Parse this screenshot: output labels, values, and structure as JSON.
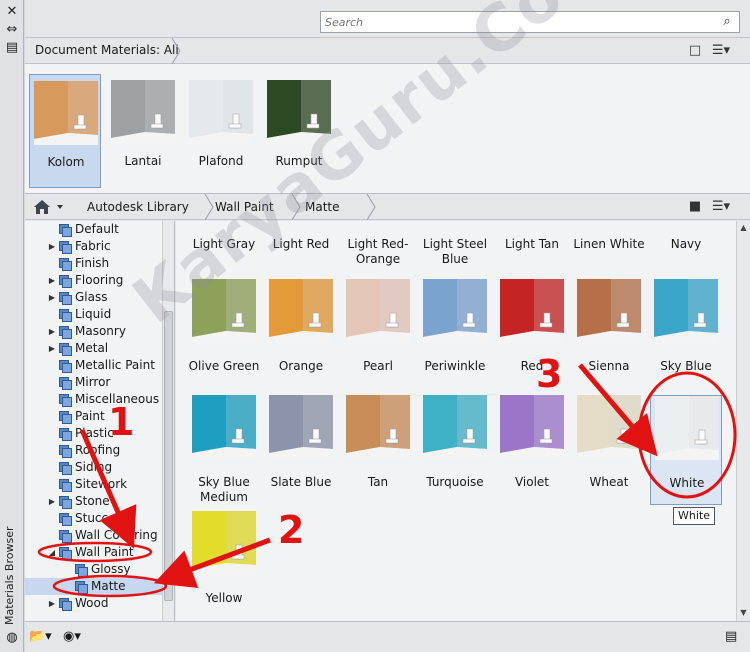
{
  "search": {
    "placeholder": "Search"
  },
  "strip": {
    "close_glyph": "✕",
    "pin_glyph": "⇔",
    "menu_glyph": "▤",
    "title": "Materials Browser",
    "bottom_glyph": "◍"
  },
  "doc_header": {
    "label": "Document Materials: All"
  },
  "doc_materials": [
    {
      "name": "Kolom",
      "color": "#d79a5c",
      "selected": true
    },
    {
      "name": "Lantai",
      "color": "#9ea0a1",
      "selected": false
    },
    {
      "name": "Plafond",
      "color": "#e6e9ec",
      "selected": false
    },
    {
      "name": "Rumput",
      "color": "#2e4a24",
      "selected": false
    }
  ],
  "breadcrumb": [
    "Autodesk Library",
    "Wall Paint",
    "Matte"
  ],
  "tree": [
    {
      "label": "Default",
      "exp": false,
      "level": 1,
      "sel": false
    },
    {
      "label": "Fabric",
      "exp": true,
      "level": 1,
      "sel": false
    },
    {
      "label": "Finish",
      "exp": false,
      "level": 1,
      "sel": false
    },
    {
      "label": "Flooring",
      "exp": true,
      "level": 1,
      "sel": false
    },
    {
      "label": "Glass",
      "exp": true,
      "level": 1,
      "sel": false
    },
    {
      "label": "Liquid",
      "exp": false,
      "level": 1,
      "sel": false
    },
    {
      "label": "Masonry",
      "exp": true,
      "level": 1,
      "sel": false
    },
    {
      "label": "Metal",
      "exp": true,
      "level": 1,
      "sel": false
    },
    {
      "label": "Metallic Paint",
      "exp": false,
      "level": 1,
      "sel": false
    },
    {
      "label": "Mirror",
      "exp": false,
      "level": 1,
      "sel": false
    },
    {
      "label": "Miscellaneous",
      "exp": false,
      "level": 1,
      "sel": false
    },
    {
      "label": "Paint",
      "exp": false,
      "level": 1,
      "sel": false
    },
    {
      "label": "Plastic",
      "exp": false,
      "level": 1,
      "sel": false
    },
    {
      "label": "Roofing",
      "exp": false,
      "level": 1,
      "sel": false
    },
    {
      "label": "Siding",
      "exp": false,
      "level": 1,
      "sel": false
    },
    {
      "label": "Sitework",
      "exp": false,
      "level": 1,
      "sel": false
    },
    {
      "label": "Stone",
      "exp": true,
      "level": 1,
      "sel": false
    },
    {
      "label": "Stucco",
      "exp": false,
      "level": 1,
      "sel": false
    },
    {
      "label": "Wall Covering",
      "exp": false,
      "level": 1,
      "sel": false
    },
    {
      "label": "Wall Paint",
      "exp": "open",
      "level": 1,
      "sel": false
    },
    {
      "label": "Glossy",
      "exp": false,
      "level": 2,
      "sel": false
    },
    {
      "label": "Matte",
      "exp": false,
      "level": 2,
      "sel": true
    },
    {
      "label": "Wood",
      "exp": true,
      "level": 1,
      "sel": false
    }
  ],
  "top_row": [
    {
      "name": "Light Gray"
    },
    {
      "name": "Light Red"
    },
    {
      "name": "Light Red-Orange"
    },
    {
      "name": "Light Steel Blue"
    },
    {
      "name": "Light Tan"
    },
    {
      "name": "Linen White"
    },
    {
      "name": "Navy"
    }
  ],
  "library_materials": [
    {
      "name": "Olive Green",
      "color": "#8ea15a"
    },
    {
      "name": "Orange",
      "color": "#e39a3a"
    },
    {
      "name": "Pearl",
      "color": "#e3c6b8"
    },
    {
      "name": "Periwinkle",
      "color": "#7aa3cf"
    },
    {
      "name": "Red",
      "color": "#c52424"
    },
    {
      "name": "Sienna",
      "color": "#b5704a"
    },
    {
      "name": "Sky Blue",
      "color": "#3aa6c9"
    },
    {
      "name": "Sky Blue Medium",
      "color": "#1e9fc0"
    },
    {
      "name": "Slate Blue",
      "color": "#8d94a9"
    },
    {
      "name": "Tan",
      "color": "#c98d59"
    },
    {
      "name": "Turquoise",
      "color": "#3fb1c6"
    },
    {
      "name": "Violet",
      "color": "#9b76c8"
    },
    {
      "name": "Wheat",
      "color": "#e4dcc6"
    },
    {
      "name": "White",
      "color": "#eceff0"
    },
    {
      "name": "Yellow",
      "color": "#e2dc2a"
    }
  ],
  "tooltip": "White",
  "watermark": "KaryaGuru.Com",
  "annotations": [
    "1",
    "2",
    "3"
  ]
}
